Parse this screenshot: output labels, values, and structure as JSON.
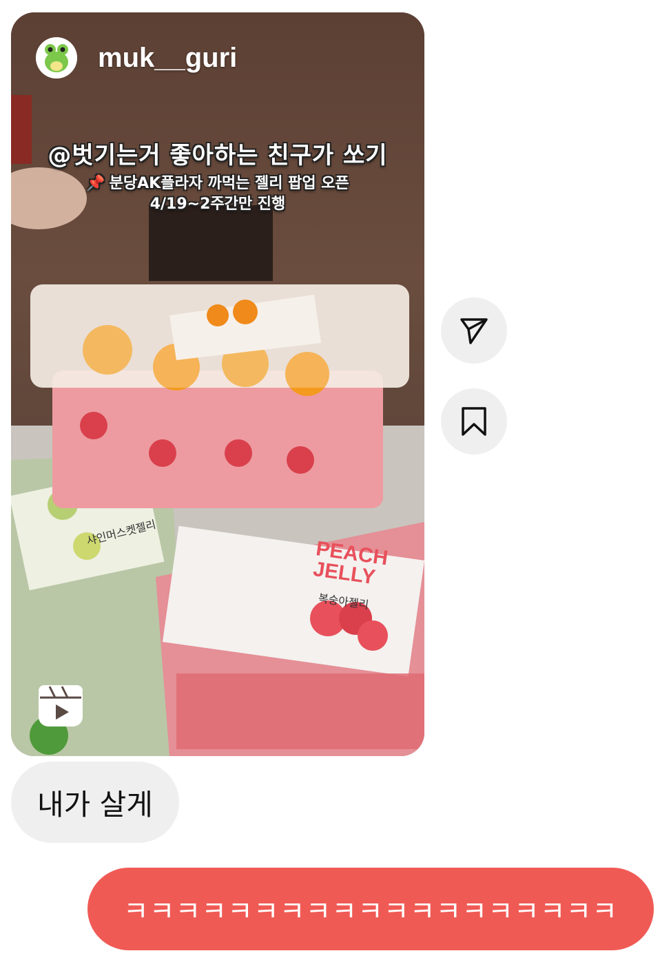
{
  "reel": {
    "username": "muk__guri",
    "caption_line1": "@벗기는거 좋아하는 친구가 쏘기",
    "caption_line2": "분당AK플라자 까먹는 젤리 팝업 오픈",
    "caption_line3": "4/19~2주간만 진행",
    "product_label_peach": "PEACH JELLY",
    "product_label_peach_kr": "복숭아젤리",
    "product_label_grape_kr": "샤인머스켓젤리",
    "avatar_icon": "frog-avatar",
    "reels_icon": "reels-icon"
  },
  "actions": {
    "share_icon": "send-icon",
    "save_icon": "bookmark-icon"
  },
  "messages": {
    "incoming_text": "내가 살게",
    "outgoing_text": "ㅋㅋㅋㅋㅋㅋㅋㅋㅋㅋㅋㅋㅋㅋㅋㅋㅋㅋㅋ"
  },
  "colors": {
    "outgoing_bubble": "#f05a55",
    "incoming_bubble": "#efefef",
    "action_button": "#efefef"
  }
}
